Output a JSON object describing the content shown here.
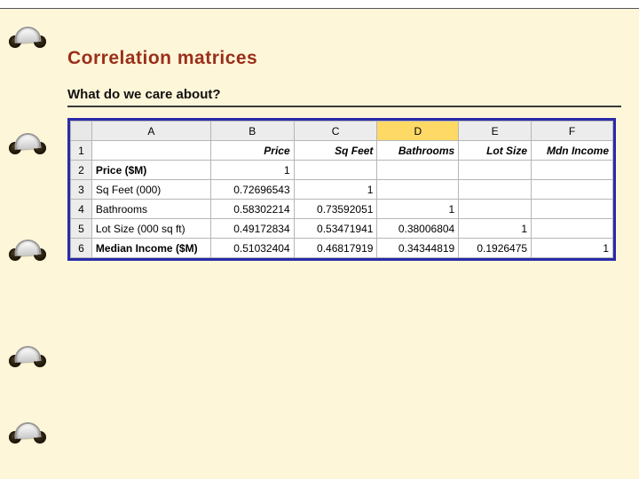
{
  "title": "Correlation matrices",
  "subtitle": "What do we care about?",
  "columns": [
    "A",
    "B",
    "C",
    "D",
    "E",
    "F"
  ],
  "selected_column": "D",
  "row_numbers": [
    "1",
    "2",
    "3",
    "4",
    "5",
    "6"
  ],
  "header_row": {
    "a": "",
    "b": "Price",
    "c": "Sq Feet",
    "d": "Bathrooms",
    "e": "Lot Size",
    "f": "Mdn Income"
  },
  "rows": [
    {
      "label": "Price ($M)",
      "b": "1",
      "c": "",
      "d": "",
      "e": "",
      "f": ""
    },
    {
      "label": "Sq Feet (000)",
      "b": "0.72696543",
      "c": "1",
      "d": "",
      "e": "",
      "f": ""
    },
    {
      "label": "Bathrooms",
      "b": "0.58302214",
      "c": "0.73592051",
      "d": "1",
      "e": "",
      "f": ""
    },
    {
      "label": "Lot Size (000 sq ft)",
      "b": "0.49172834",
      "c": "0.53471941",
      "d": "0.38006804",
      "e": "1",
      "f": ""
    },
    {
      "label": "Median Income ($M)",
      "b": "0.51032404",
      "c": "0.46817919",
      "d": "0.34344819",
      "e": "0.1926475",
      "f": "1"
    }
  ],
  "chart_data": {
    "type": "table",
    "title": "Correlation matrix",
    "variables": [
      "Price ($M)",
      "Sq Feet (000)",
      "Bathrooms",
      "Lot Size (000 sq ft)",
      "Median Income ($M)"
    ],
    "matrix": [
      [
        1,
        null,
        null,
        null,
        null
      ],
      [
        0.72696543,
        1,
        null,
        null,
        null
      ],
      [
        0.58302214,
        0.73592051,
        1,
        null,
        null
      ],
      [
        0.49172834,
        0.53471941,
        0.38006804,
        1,
        null
      ],
      [
        0.51032404,
        0.46817919,
        0.34344819,
        0.1926475,
        1
      ]
    ]
  }
}
